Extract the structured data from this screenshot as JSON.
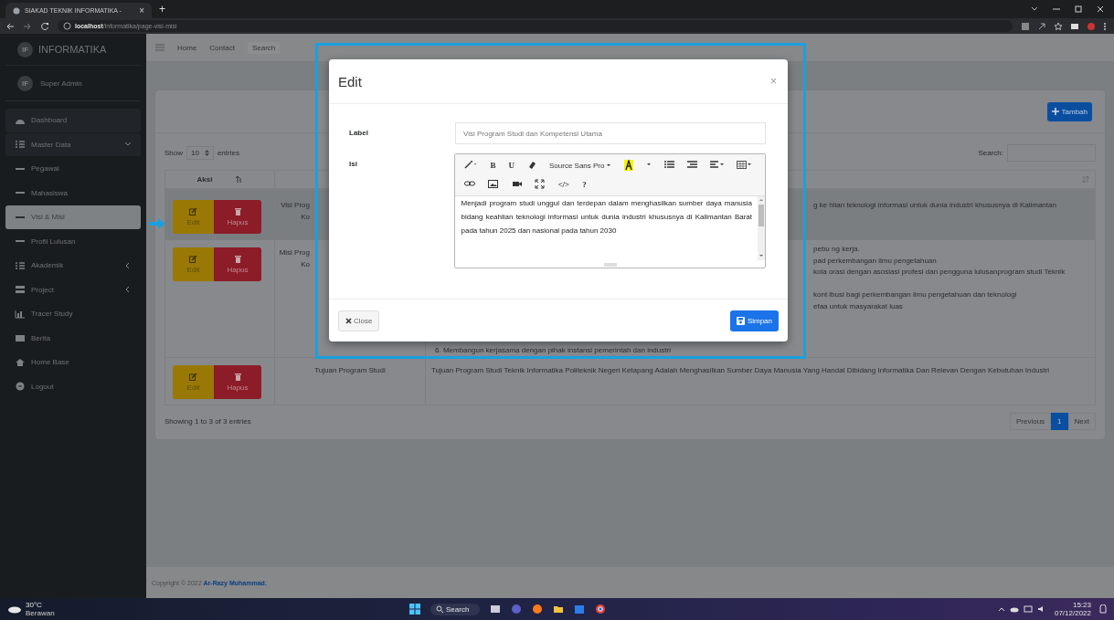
{
  "browser": {
    "tab_title": "SIAKAD TEKNIK INFORMATIKA -",
    "tab_close": "×",
    "new_tab": "+",
    "url_host": "localhost",
    "url_path": "/informatika/page-visi-misi"
  },
  "sidebar": {
    "logo": "IF",
    "brand": "INFORMATIKA",
    "user_logo": "IF",
    "user": "Super Admin",
    "items": [
      {
        "label": "Dashboard",
        "kind": "item",
        "selected": false
      },
      {
        "label": "Master Data",
        "kind": "group",
        "selected": false,
        "expanded": true,
        "children": [
          {
            "label": "Pegawai",
            "selected": false
          },
          {
            "label": "Mahasiswa",
            "selected": false
          },
          {
            "label": "Visi & Misi",
            "selected": true
          },
          {
            "label": "Profil Lulusan",
            "selected": false
          }
        ]
      },
      {
        "label": "Akademik",
        "kind": "group",
        "selected": false,
        "expanded": false
      },
      {
        "label": "Project",
        "kind": "group",
        "selected": false,
        "expanded": false
      },
      {
        "label": "Tracer Study",
        "kind": "item",
        "selected": false
      },
      {
        "label": "Berita",
        "kind": "item",
        "selected": false
      },
      {
        "label": "Home Base",
        "kind": "item",
        "selected": false
      },
      {
        "label": "Logout",
        "kind": "item",
        "selected": false
      }
    ]
  },
  "navbar": {
    "links": [
      "Home",
      "Contact"
    ],
    "search": "Search"
  },
  "card": {
    "add_button": "Tambah",
    "show": "Show",
    "length": "10",
    "entries": "entries",
    "search_label": "Search:",
    "table": {
      "columns": [
        "Aksi"
      ],
      "rows": [
        {
          "edit": "Edit",
          "delete": "Hapus",
          "highlighted": true,
          "label_lines": [
            "Visi Prog",
            "Ko"
          ],
          "content_lines": [
            "g ke hlian teknologi informasi untuk dunia industri khususnya di Kalimantan"
          ]
        },
        {
          "edit": "Edit",
          "delete": "Hapus",
          "highlighted": false,
          "label_lines": [
            "Misi Prog",
            "Ko"
          ],
          "content_lines": [
            "pebu ng kerja.",
            "pad perkembangan ilmu pengetahuan",
            "kola orasi dengan asosiasi profesi dan pengguna lulusanprogram studi Teknik",
            "kont ibusi bagi perkembangan ilmu pengetahuan dan teknologi",
            "efaa untuk masyarakat luas"
          ],
          "trailing_line": "6. Membangun kerjasama dengan pihak instansi pemerintah dan industri"
        },
        {
          "edit": "Edit",
          "delete": "Hapus",
          "highlighted": false,
          "label_lines": [
            "Tujuan Program Studi"
          ],
          "content": "Tujuan Program Studi Teknik Informatika Politeknik Negeri Ketapang Adalah Menghasilkan Sumber Daya Manusia Yang Handal Dibidang Informatika Dan Relevan Dengan Kebutuhan Industri"
        }
      ]
    },
    "info": "Showing 1 to 3 of 3 entries",
    "pagination": [
      {
        "label": "Previous",
        "selected": false
      },
      {
        "label": "1",
        "selected": true
      },
      {
        "label": "Next",
        "selected": false
      }
    ]
  },
  "footer": {
    "text": "Copyright © 2022 ",
    "author": "Ar-Razy Muhammad."
  },
  "modal": {
    "title": "Edit",
    "close": "×",
    "label_caption": "Label",
    "label_value": "Visi Program Studi dan Kompetensi Utama",
    "isi_caption": "Isi",
    "toolbar": [
      [
        {
          "kind": "wand"
        },
        {
          "kind": "text",
          "label": "B"
        },
        {
          "kind": "text",
          "label": "U"
        },
        {
          "kind": "eraser"
        },
        {
          "kind": "dropdown",
          "label": "Source Sans Pro"
        },
        {
          "kind": "highlight"
        },
        {
          "kind": "caret"
        },
        {
          "kind": "ul"
        },
        {
          "kind": "ol"
        },
        {
          "kind": "align"
        },
        {
          "kind": "table"
        }
      ],
      [
        {
          "kind": "link"
        },
        {
          "kind": "picture"
        },
        {
          "kind": "video"
        },
        {
          "kind": "fullscreen"
        },
        {
          "kind": "text",
          "label": "</>"
        },
        {
          "kind": "text",
          "label": "?"
        }
      ]
    ],
    "content": "Menjadi program studi unggul dan terdepan dalam menghasilkan sumber daya manusia bidang keahlian teknologi informasi untuk dunia industri khususnya di Kalimantan Barat pada tahun 2025 dan nasional pada tahun 2030",
    "close_button": "Close",
    "save_button": "Simpan"
  },
  "taskbar": {
    "temp": "30°C",
    "weather": "Berawan",
    "search": "Search",
    "time": "15:23",
    "date": "07/12/2022"
  }
}
